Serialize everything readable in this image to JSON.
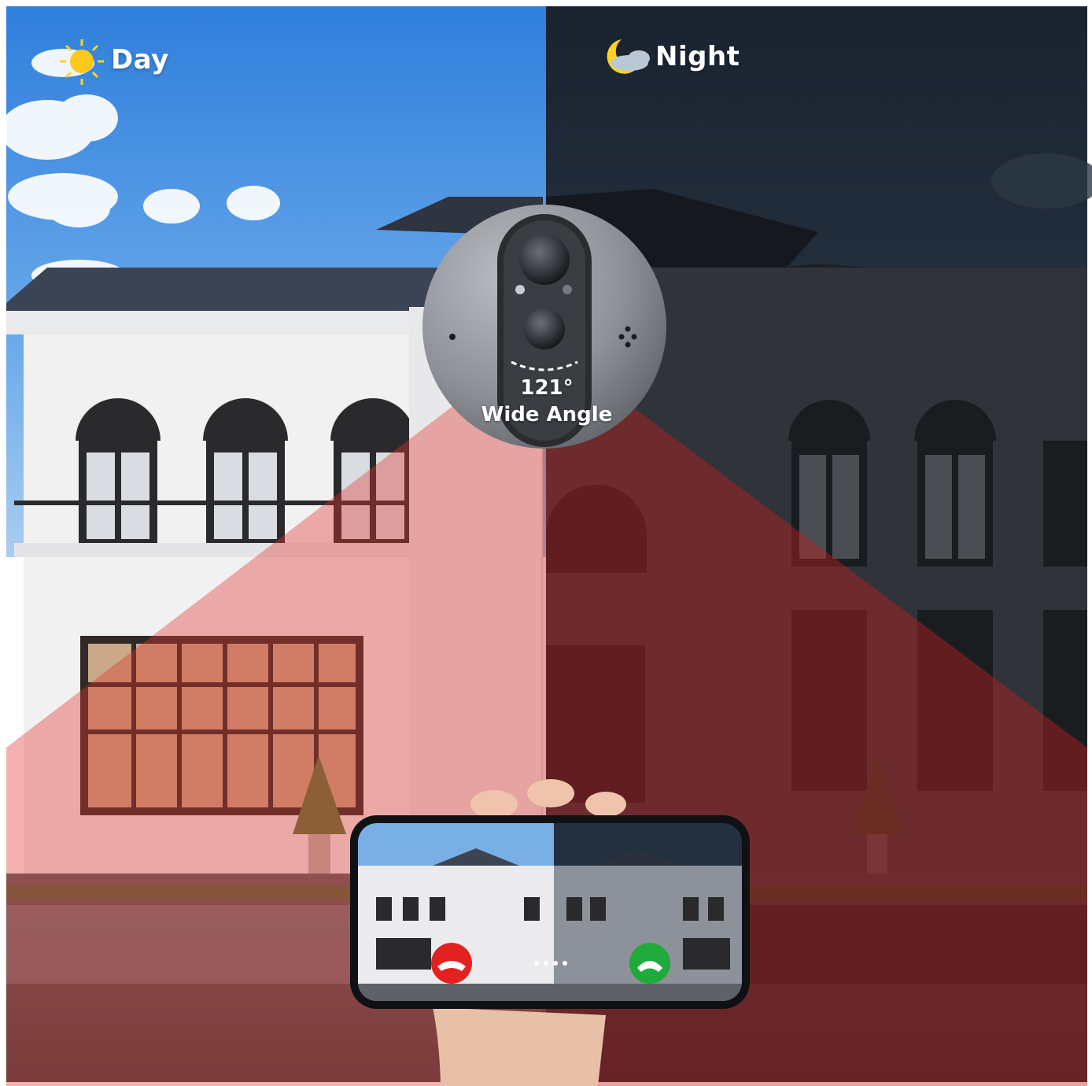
{
  "labels": {
    "day": "Day",
    "night": "Night",
    "angle_degrees": "121°",
    "angle_text": "Wide Angle"
  },
  "icons": {
    "day": "sun-cloud-icon",
    "night": "moon-cloud-icon",
    "decline": "phone-decline-icon",
    "accept": "phone-accept-icon"
  },
  "colors": {
    "sky_day": "#3f8ee6",
    "sky_night": "#1b2634",
    "ir_beam": "#e0342e",
    "decline_button": "#e32121",
    "accept_button": "#1fab3c",
    "device_body": "#8c8f94"
  }
}
